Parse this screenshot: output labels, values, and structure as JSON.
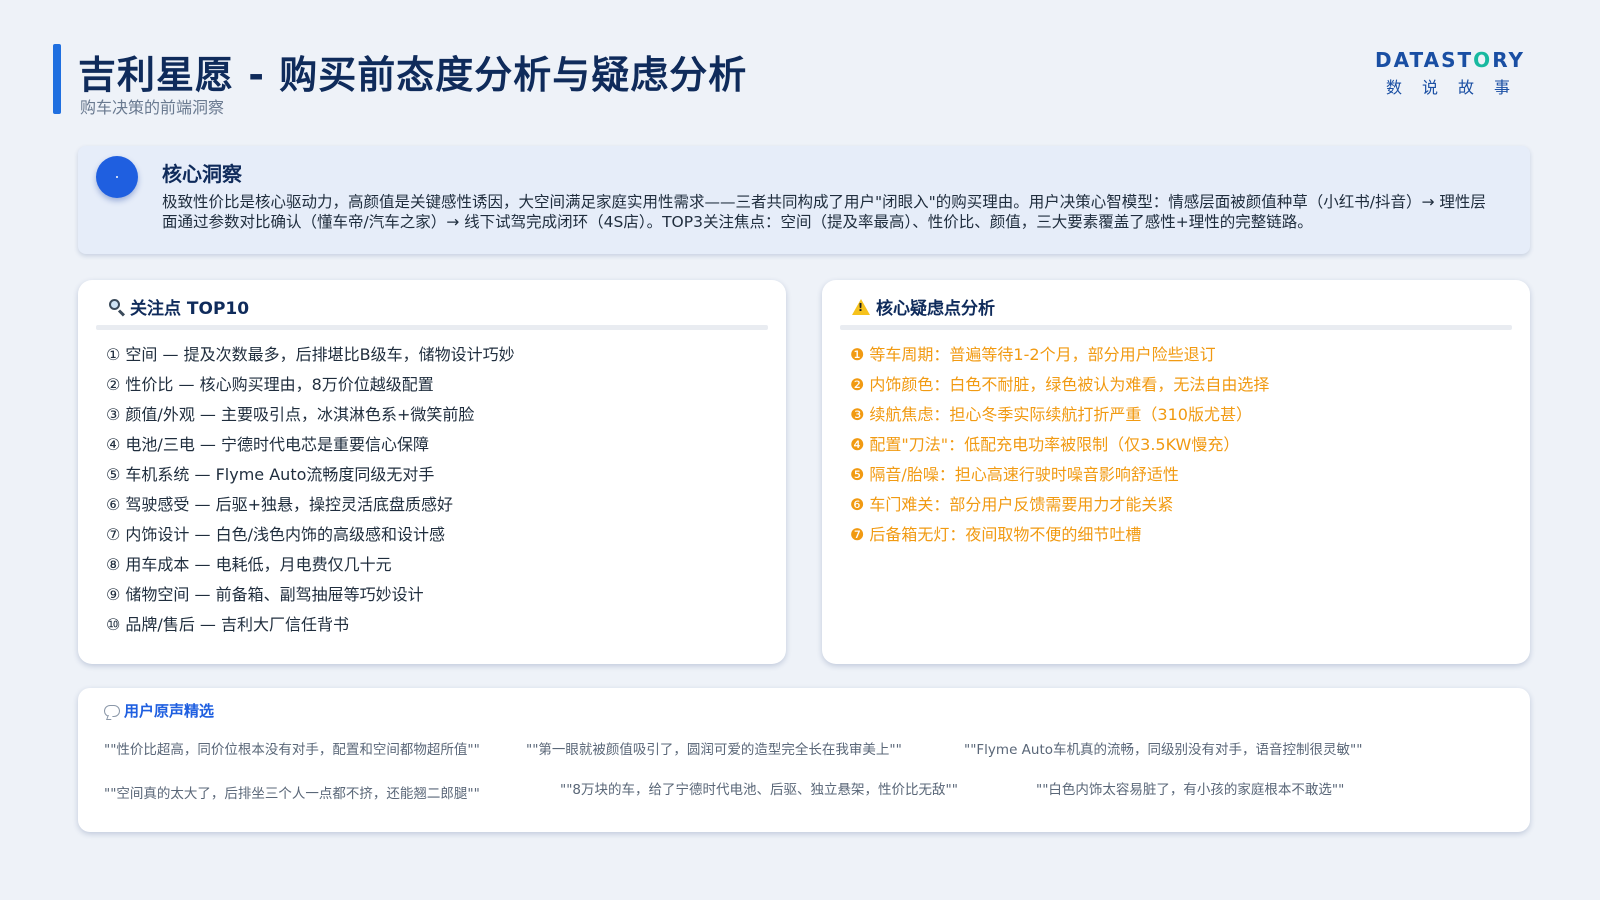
{
  "header": {
    "title": "吉利星愿 - 购买前态度分析与疑虑分析",
    "subtitle": "购车决策的前端洞察"
  },
  "logo": {
    "main_pre": "DATAST",
    "main_o": "O",
    "main_post": "RY",
    "sub": "数说故事"
  },
  "insight": {
    "title": "核心洞察",
    "text": "极致性价比是核心驱动力，高颜值是关键感性诱因，大空间满足家庭实用性需求——三者共同构成了用户\"闭眼入\"的购买理由。用户决策心智模型：情感层面被颜值种草（小红书/抖音）→ 理性层面通过参数对比确认（懂车帝/汽车之家）→ 线下试驾完成闭环（4S店）。TOP3关注焦点：空间（提及率最高）、性价比、颜值，三大要素覆盖了感性+理性的完整链路。"
  },
  "focus": {
    "title": "关注点 TOP10",
    "items": [
      "① 空间 — 提及次数最多，后排堪比B级车，储物设计巧妙",
      "② 性价比 — 核心购买理由，8万价位越级配置",
      "③ 颜值/外观 — 主要吸引点，冰淇淋色系+微笑前脸",
      "④ 电池/三电 — 宁德时代电芯是重要信心保障",
      "⑤ 车机系统 — Flyme Auto流畅度同级无对手",
      "⑥ 驾驶感受 — 后驱+独悬，操控灵活底盘质感好",
      "⑦ 内饰设计 — 白色/浅色内饰的高级感和设计感",
      "⑧ 用车成本 — 电耗低，月电费仅几十元",
      "⑨ 储物空间 — 前备箱、副驾抽屉等巧妙设计",
      "⑩ 品牌/售后 — 吉利大厂信任背书"
    ]
  },
  "concerns": {
    "title": "核心疑虑点分析",
    "items": [
      "❶ 等车周期：普遍等待1-2个月，部分用户险些退订",
      "❷ 内饰颜色：白色不耐脏，绿色被认为难看，无法自由选择",
      "❸ 续航焦虑：担心冬季实际续航打折严重（310版尤甚）",
      "❹ 配置\"刀法\"：低配充电功率被限制（仅3.5KW慢充）",
      "❺ 隔音/胎噪：担心高速行驶时噪音影响舒适性",
      "❻ 车门难关：部分用户反馈需要用力才能关紧",
      "❼ 后备箱无灯：夜间取物不便的细节吐槽"
    ]
  },
  "voices": {
    "title": "用户原声精选",
    "quotes": [
      "\"\"性价比超高，同价位根本没有对手，配置和空间都物超所值\"\"",
      "\"\"第一眼就被颜值吸引了，圆润可爱的造型完全长在我审美上\"\"",
      "\"\"Flyme Auto车机真的流畅，同级别没有对手，语音控制很灵敏\"\"",
      "\"\"空间真的太大了，后排坐三个人一点都不挤，还能翘二郎腿\"\"",
      "\"\"8万块的车，给了宁德时代电池、后驱、独立悬架，性价比无敌\"\"",
      "\"\"白色内饰太容易脏了，有小孩的家庭根本不敢选\"\""
    ]
  }
}
